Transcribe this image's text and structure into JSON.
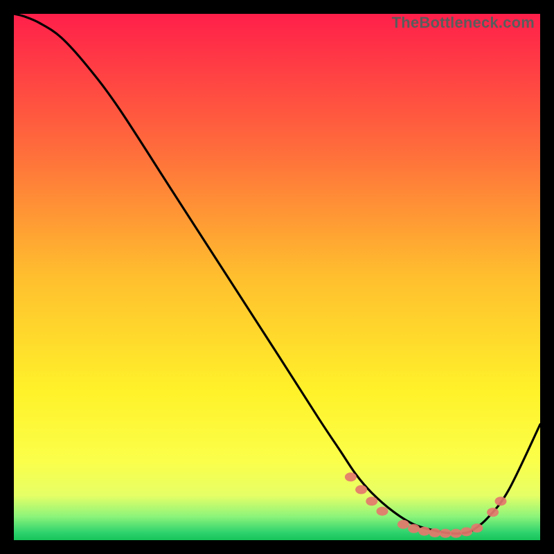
{
  "watermark": "TheBottleneck.com",
  "chart_data": {
    "type": "line",
    "title": "",
    "xlabel": "",
    "ylabel": "",
    "xlim": [
      0,
      100
    ],
    "ylim": [
      0,
      100
    ],
    "grid": false,
    "legend": false,
    "gradient_stops": [
      {
        "offset": 0.0,
        "color": "#ff1f4a"
      },
      {
        "offset": 0.25,
        "color": "#ff6a3c"
      },
      {
        "offset": 0.5,
        "color": "#ffbf2e"
      },
      {
        "offset": 0.72,
        "color": "#fff22a"
      },
      {
        "offset": 0.85,
        "color": "#fbff4a"
      },
      {
        "offset": 0.915,
        "color": "#e6ff66"
      },
      {
        "offset": 0.955,
        "color": "#8cf47a"
      },
      {
        "offset": 0.985,
        "color": "#2fd36e"
      },
      {
        "offset": 1.0,
        "color": "#17c55a"
      }
    ],
    "curve": {
      "x": [
        0,
        2,
        5,
        9,
        14,
        20,
        30,
        40,
        50,
        58,
        62,
        65,
        68,
        72,
        76,
        80,
        83,
        85,
        87,
        90,
        94,
        100
      ],
      "y": [
        100,
        99.5,
        98.2,
        95.5,
        90,
        82,
        66.5,
        51,
        35.5,
        23,
        17,
        12.5,
        9,
        5.5,
        3,
        1.8,
        1.3,
        1.3,
        1.8,
        4.2,
        9.5,
        22
      ]
    },
    "markers": [
      {
        "x": 64,
        "y": 12.0
      },
      {
        "x": 66,
        "y": 9.6
      },
      {
        "x": 68,
        "y": 7.4
      },
      {
        "x": 70,
        "y": 5.5
      },
      {
        "x": 74,
        "y": 3.0
      },
      {
        "x": 76,
        "y": 2.2
      },
      {
        "x": 78,
        "y": 1.7
      },
      {
        "x": 80,
        "y": 1.4
      },
      {
        "x": 82,
        "y": 1.3
      },
      {
        "x": 84,
        "y": 1.3
      },
      {
        "x": 86,
        "y": 1.6
      },
      {
        "x": 88,
        "y": 2.3
      },
      {
        "x": 91,
        "y": 5.3
      },
      {
        "x": 92.5,
        "y": 7.4
      }
    ]
  }
}
